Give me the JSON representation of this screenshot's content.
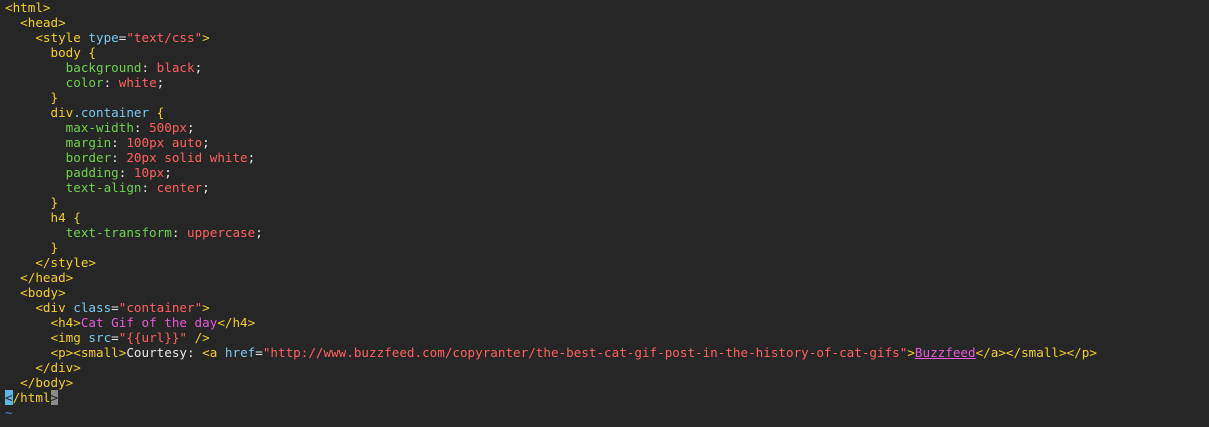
{
  "editor": {
    "lines": [
      [
        {
          "t": "<html>",
          "c": "tag"
        }
      ],
      [
        {
          "t": "  <head>",
          "c": "tag"
        }
      ],
      [
        {
          "t": "    <style ",
          "c": "tag"
        },
        {
          "t": "type",
          "c": "attr"
        },
        {
          "t": "=",
          "c": "punct"
        },
        {
          "t": "\"text/css\"",
          "c": "str"
        },
        {
          "t": ">",
          "c": "tag"
        }
      ],
      [
        {
          "t": "      body {",
          "c": "sel"
        }
      ],
      [
        {
          "t": "        background",
          "c": "prop"
        },
        {
          "t": ": ",
          "c": "punct"
        },
        {
          "t": "black",
          "c": "val"
        },
        {
          "t": ";",
          "c": "punct"
        }
      ],
      [
        {
          "t": "        color",
          "c": "prop"
        },
        {
          "t": ": ",
          "c": "punct"
        },
        {
          "t": "white",
          "c": "val"
        },
        {
          "t": ";",
          "c": "punct"
        }
      ],
      [
        {
          "t": "      }",
          "c": "sel"
        }
      ],
      [
        {
          "t": "      div",
          "c": "sel"
        },
        {
          "t": ".container",
          "c": "cls"
        },
        {
          "t": " {",
          "c": "sel"
        }
      ],
      [
        {
          "t": "        max-width",
          "c": "prop"
        },
        {
          "t": ": ",
          "c": "punct"
        },
        {
          "t": "500px",
          "c": "val"
        },
        {
          "t": ";",
          "c": "punct"
        }
      ],
      [
        {
          "t": "        margin",
          "c": "prop"
        },
        {
          "t": ": ",
          "c": "punct"
        },
        {
          "t": "100px auto",
          "c": "val"
        },
        {
          "t": ";",
          "c": "punct"
        }
      ],
      [
        {
          "t": "        border",
          "c": "prop"
        },
        {
          "t": ": ",
          "c": "punct"
        },
        {
          "t": "20px solid white",
          "c": "val"
        },
        {
          "t": ";",
          "c": "punct"
        }
      ],
      [
        {
          "t": "        padding",
          "c": "prop"
        },
        {
          "t": ": ",
          "c": "punct"
        },
        {
          "t": "10px",
          "c": "val"
        },
        {
          "t": ";",
          "c": "punct"
        }
      ],
      [
        {
          "t": "        text-align",
          "c": "prop"
        },
        {
          "t": ": ",
          "c": "punct"
        },
        {
          "t": "center",
          "c": "val"
        },
        {
          "t": ";",
          "c": "punct"
        }
      ],
      [
        {
          "t": "      }",
          "c": "sel"
        }
      ],
      [
        {
          "t": "      h4 {",
          "c": "sel"
        }
      ],
      [
        {
          "t": "        text-transform",
          "c": "prop"
        },
        {
          "t": ": ",
          "c": "punct"
        },
        {
          "t": "uppercase",
          "c": "val"
        },
        {
          "t": ";",
          "c": "punct"
        }
      ],
      [
        {
          "t": "      }",
          "c": "sel"
        }
      ],
      [
        {
          "t": "    </style>",
          "c": "tag"
        }
      ],
      [
        {
          "t": "  </head>",
          "c": "tag"
        }
      ],
      [
        {
          "t": "  <body>",
          "c": "tag"
        }
      ],
      [
        {
          "t": "    <div ",
          "c": "tag"
        },
        {
          "t": "class",
          "c": "attr"
        },
        {
          "t": "=",
          "c": "punct"
        },
        {
          "t": "\"container\"",
          "c": "str"
        },
        {
          "t": ">",
          "c": "tag"
        }
      ],
      [
        {
          "t": "      <h4>",
          "c": "tag"
        },
        {
          "t": "Cat Gif of the day",
          "c": "head"
        },
        {
          "t": "</h4>",
          "c": "tag"
        }
      ],
      [
        {
          "t": "      <img ",
          "c": "tag"
        },
        {
          "t": "src",
          "c": "attr"
        },
        {
          "t": "=",
          "c": "punct"
        },
        {
          "t": "\"{{url}}\"",
          "c": "str"
        },
        {
          "t": " />",
          "c": "tag"
        }
      ],
      [
        {
          "t": "      <p><small>",
          "c": "tag"
        },
        {
          "t": "Courtesy: ",
          "c": "text"
        },
        {
          "t": "<a ",
          "c": "tag"
        },
        {
          "t": "href",
          "c": "attr"
        },
        {
          "t": "=",
          "c": "punct"
        },
        {
          "t": "\"http://www.buzzfeed.com/copyranter/the-best-cat-gif-post-in-the-history-of-cat-gifs\"",
          "c": "str"
        },
        {
          "t": ">",
          "c": "tag"
        },
        {
          "t": "Buzzfeed",
          "c": "link"
        },
        {
          "t": "</a></small></p>",
          "c": "tag"
        }
      ],
      [
        {
          "t": "    </div>",
          "c": "tag"
        }
      ],
      [
        {
          "t": "  </body>",
          "c": "tag"
        }
      ],
      [
        {
          "t": "<",
          "c": "cursor"
        },
        {
          "t": "/html",
          "c": "tag"
        },
        {
          "t": ">",
          "c": "cursor2"
        }
      ],
      [
        {
          "t": "~",
          "c": "tilde"
        }
      ]
    ]
  }
}
